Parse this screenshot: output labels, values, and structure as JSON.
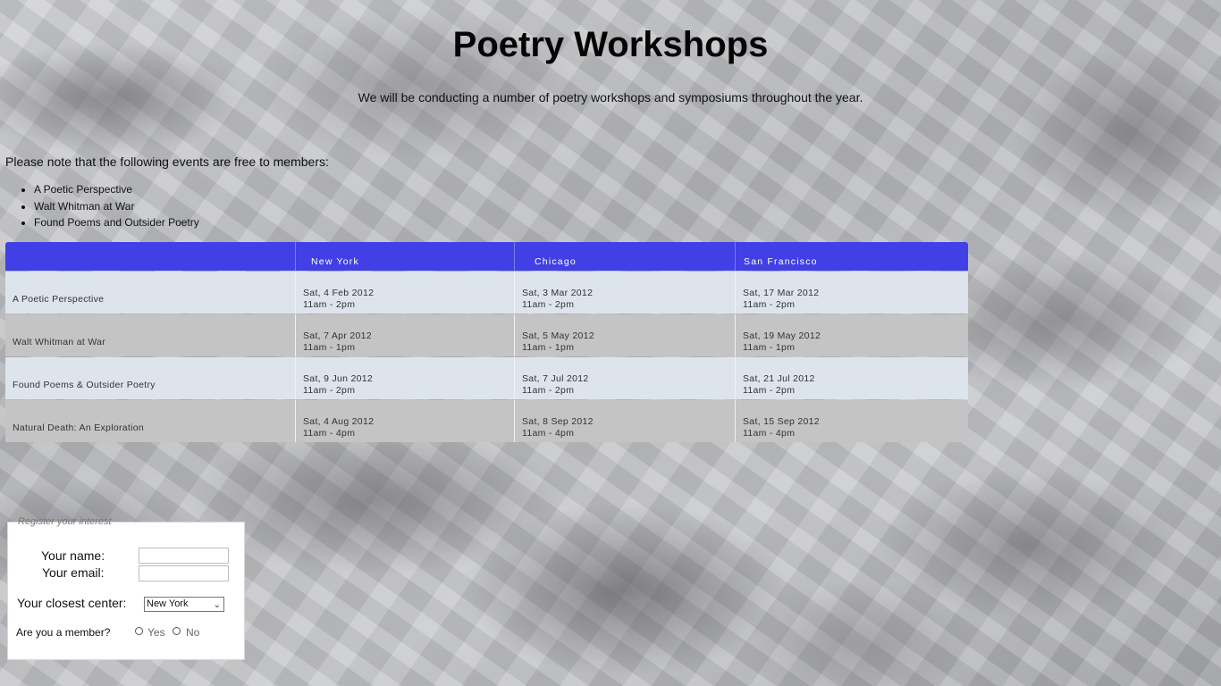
{
  "page": {
    "title": "Poetry Workshops",
    "intro": "We will be conducting a number of poetry workshops and symposiums throughout the year.",
    "note": "Please note that the following events are free to members:",
    "free_events": [
      "A Poetic Perspective",
      "Walt Whitman at War",
      "Found Poems and Outsider Poetry"
    ]
  },
  "schedule": {
    "header_color": "#4040e6",
    "columns": [
      "",
      "New York",
      "Chicago",
      "San Francisco"
    ],
    "rows": [
      {
        "name": "A Poetic Perspective",
        "ny_date": "Sat, 4 Feb 2012",
        "ny_time": "11am - 2pm",
        "chi_date": "Sat, 3 Mar 2012",
        "chi_time": "11am - 2pm",
        "sf_date": "Sat, 17 Mar 2012",
        "sf_time": "11am - 2pm"
      },
      {
        "name": "Walt Whitman at War",
        "ny_date": "Sat, 7 Apr 2012",
        "ny_time": "11am - 1pm",
        "chi_date": "Sat, 5 May 2012",
        "chi_time": "11am - 1pm",
        "sf_date": "Sat, 19 May 2012",
        "sf_time": "11am - 1pm"
      },
      {
        "name": "Found Poems & Outsider Poetry",
        "ny_date": "Sat, 9 Jun 2012",
        "ny_time": "11am - 2pm",
        "chi_date": "Sat, 7 Jul 2012",
        "chi_time": "11am - 2pm",
        "sf_date": "Sat, 21 Jul 2012",
        "sf_time": "11am - 2pm"
      },
      {
        "name": "Natural Death: An Exploration",
        "ny_date": "Sat, 4 Aug 2012",
        "ny_time": "11am - 4pm",
        "chi_date": "Sat, 8 Sep 2012",
        "chi_time": "11am - 4pm",
        "sf_date": "Sat, 15 Sep 2012",
        "sf_time": "11am - 4pm"
      }
    ]
  },
  "form": {
    "legend": "Register your interest",
    "name_label": "Your name:",
    "name_value": "",
    "email_label": "Your email:",
    "email_value": "",
    "center_label": "Your closest center:",
    "center_selected": "New York",
    "member_question": "Are you a member?",
    "yes_label": "Yes",
    "no_label": "No"
  }
}
